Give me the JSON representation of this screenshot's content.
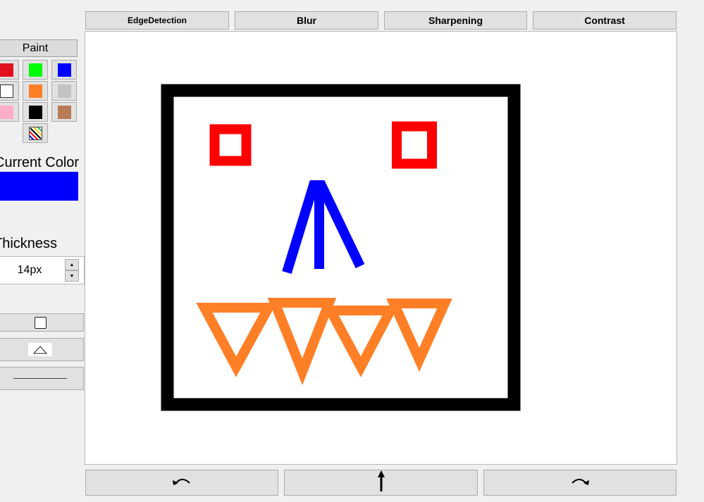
{
  "filters": [
    {
      "label": "EdgeDetection"
    },
    {
      "label": "Blur"
    },
    {
      "label": "Sharpening"
    },
    {
      "label": "Contrast"
    }
  ],
  "sidebar": {
    "paint_label": "Paint",
    "palette": [
      "#e1101e",
      "#00ff00",
      "#0000ff",
      "#ffffff",
      "#ff7f27",
      "#c3c3c3",
      "#ffaec9",
      "#000000",
      "#b97a57"
    ],
    "current_color_label": "Current Color",
    "current_color": "#0000ff",
    "thickness_label": "Thickness",
    "thickness_value": "14px"
  },
  "bottom": {
    "undo_icon": "undo-arrow-icon",
    "center_icon": "upload-arrow-icon",
    "redo_icon": "redo-arrow-icon"
  },
  "drawing": {
    "frame_color": "#000000",
    "eye_color": "#ff0000",
    "nose_color": "#0000ff",
    "teeth_color": "#ff7f27"
  }
}
